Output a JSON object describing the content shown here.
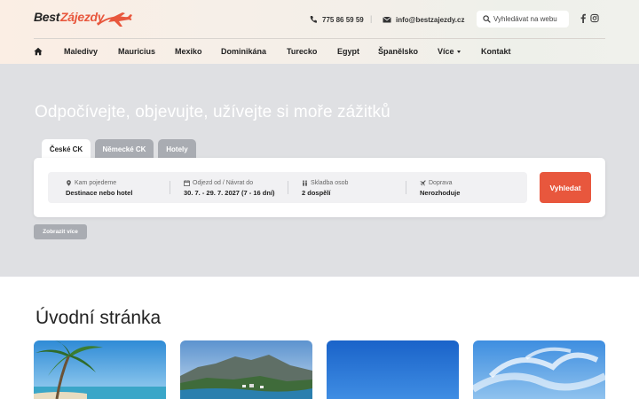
{
  "logo": {
    "part1": "Best",
    "part2": "Zájezdy"
  },
  "header": {
    "phone": "775 86 59 59",
    "separator": "|",
    "email": "info@bestzajezdy.cz",
    "search_placeholder": "Vyhledávat na webu"
  },
  "nav": {
    "items": [
      "Maledivy",
      "Mauricius",
      "Mexiko",
      "Dominikána",
      "Turecko",
      "Egypt",
      "Španělsko",
      "Více",
      "Kontakt"
    ]
  },
  "hero": {
    "title": "Odpočívejte, objevujte, užívejte si moře zážitků",
    "tabs": [
      "České CK",
      "Německé CK",
      "Hotely"
    ],
    "fields": [
      {
        "label": "Kam pojedeme",
        "value": "Destinace nebo hotel",
        "icon": "location-pin-icon"
      },
      {
        "label": "Odjezd od / Návrat do",
        "value": "30. 7. - 29. 7. 2027 (7 - 16 dní)",
        "icon": "calendar-icon"
      },
      {
        "label": "Skladba osob",
        "value": "2 dospělí",
        "icon": "people-icon"
      },
      {
        "label": "Doprava",
        "value": "Nerozhoduje",
        "icon": "plane-icon"
      }
    ],
    "search_button": "Vyhledat",
    "more_button": "Zobrazit více"
  },
  "main": {
    "title": "Úvodní stránka"
  },
  "colors": {
    "accent": "#e8573d",
    "hero_bg": "#dfe0e3",
    "tab_inactive": "#a9acb2"
  }
}
